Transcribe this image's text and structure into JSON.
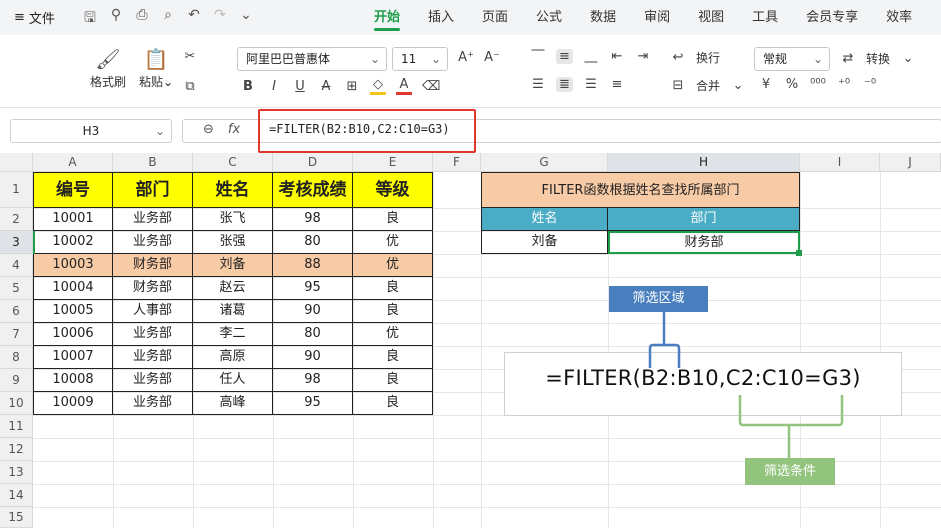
{
  "menu": {
    "file_label": "文件"
  },
  "tabs": [
    "开始",
    "插入",
    "页面",
    "公式",
    "数据",
    "审阅",
    "视图",
    "工具",
    "会员专享",
    "效率"
  ],
  "active_tab": "开始",
  "ribbon": {
    "format_painter": "格式刷",
    "paste": "粘贴",
    "font_name": "阿里巴巴普惠体",
    "font_size": "11",
    "wrap": "换行",
    "merge": "合并",
    "number_format": "常规",
    "convert": "转换"
  },
  "formula_bar": {
    "cell_ref": "H3",
    "fx": "fx",
    "formula": "=FILTER(B2:B10,C2:C10=G3)"
  },
  "columns": [
    "A",
    "B",
    "C",
    "D",
    "E",
    "F",
    "G",
    "H",
    "I",
    "J"
  ],
  "rows": [
    "1",
    "2",
    "3",
    "4",
    "5",
    "6",
    "7",
    "8",
    "9",
    "10",
    "11",
    "12",
    "13",
    "14",
    "15"
  ],
  "table": {
    "headers": [
      "编号",
      "部门",
      "姓名",
      "考核成绩",
      "等级"
    ],
    "rows": [
      [
        "10001",
        "业务部",
        "张飞",
        "98",
        "良"
      ],
      [
        "10002",
        "业务部",
        "张强",
        "80",
        "优"
      ],
      [
        "10003",
        "财务部",
        "刘备",
        "88",
        "优"
      ],
      [
        "10004",
        "财务部",
        "赵云",
        "95",
        "良"
      ],
      [
        "10005",
        "人事部",
        "诸葛",
        "90",
        "良"
      ],
      [
        "10006",
        "业务部",
        "李二",
        "80",
        "优"
      ],
      [
        "10007",
        "业务部",
        "高原",
        "90",
        "良"
      ],
      [
        "10008",
        "业务部",
        "任人",
        "98",
        "良"
      ],
      [
        "10009",
        "业务部",
        "高峰",
        "95",
        "良"
      ]
    ]
  },
  "lookup": {
    "title": "FILTER函数根据姓名查找所属部门",
    "name_header": "姓名",
    "dept_header": "部门",
    "name_value": "刘备",
    "dept_value": "财务部"
  },
  "callout": {
    "formula": "=FILTER(B2:B10,C2:C10=G3)",
    "range_label": "筛选区域",
    "condition_label": "筛选条件"
  },
  "colors": {
    "accent_green": "#1e9e4a",
    "header_yellow": "#ffff00",
    "highlight_orange": "#f8cba7",
    "teal_header": "#4bacc6",
    "callout_blue": "#4a7fbf",
    "callout_green": "#93c47d",
    "red_frame": "#e0362c"
  }
}
